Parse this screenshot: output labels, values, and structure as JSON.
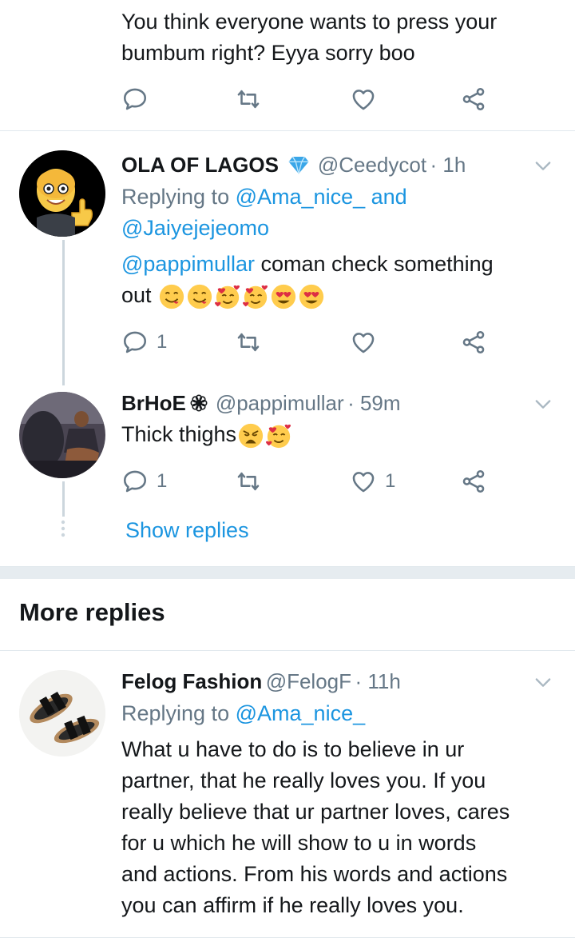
{
  "top_tweet": {
    "text_line1": "You think everyone wants to press your",
    "text_line2": "bumbum right? Eyya sorry boo",
    "actions": {
      "reply_count": "",
      "retweet_count": "",
      "like_count": ""
    }
  },
  "tweet_ola": {
    "display_name": "OLA OF LAGOS",
    "handle": "@Ceedycot",
    "time": "· 1h",
    "replying_prefix": "Replying to",
    "replying_user1": "@Ama_nice_",
    "replying_and": "and",
    "replying_user2": "@Jaiyejejeomo",
    "mention": "@pappimullar",
    "text_rest": " coman check something",
    "text_line2": "out",
    "reply_count": "1",
    "retweet_count": "",
    "like_count": ""
  },
  "tweet_brhoe": {
    "display_name": "BrHoE",
    "handle": "@pappimullar",
    "time": "· 59m",
    "text": "Thick thighs",
    "reply_count": "1",
    "retweet_count": "",
    "like_count": "1",
    "show_replies": "Show replies"
  },
  "more_replies": {
    "heading": "More replies"
  },
  "tweet_felog": {
    "display_name": "Felog Fashion",
    "handle": "@FelogF",
    "time": "· 11h",
    "replying_prefix": "Replying to",
    "replying_user1": "@Ama_nice_",
    "lines": [
      "What u have to do is to believe in ur",
      "partner, that he really loves you. If you",
      "really believe that ur partner loves, cares",
      "for u which he will show to u in words",
      "and actions. From his words and actions",
      "you can affirm if he really loves you."
    ]
  },
  "colors": {
    "accent": "#1b95e0",
    "muted": "#657786",
    "divider": "#e1e8ed",
    "gap": "#e6ecf0"
  },
  "icons": [
    "reply-icon",
    "retweet-icon",
    "like-icon",
    "share-icon",
    "chevron-down-icon",
    "verified-diamond-icon",
    "flower-icon"
  ]
}
